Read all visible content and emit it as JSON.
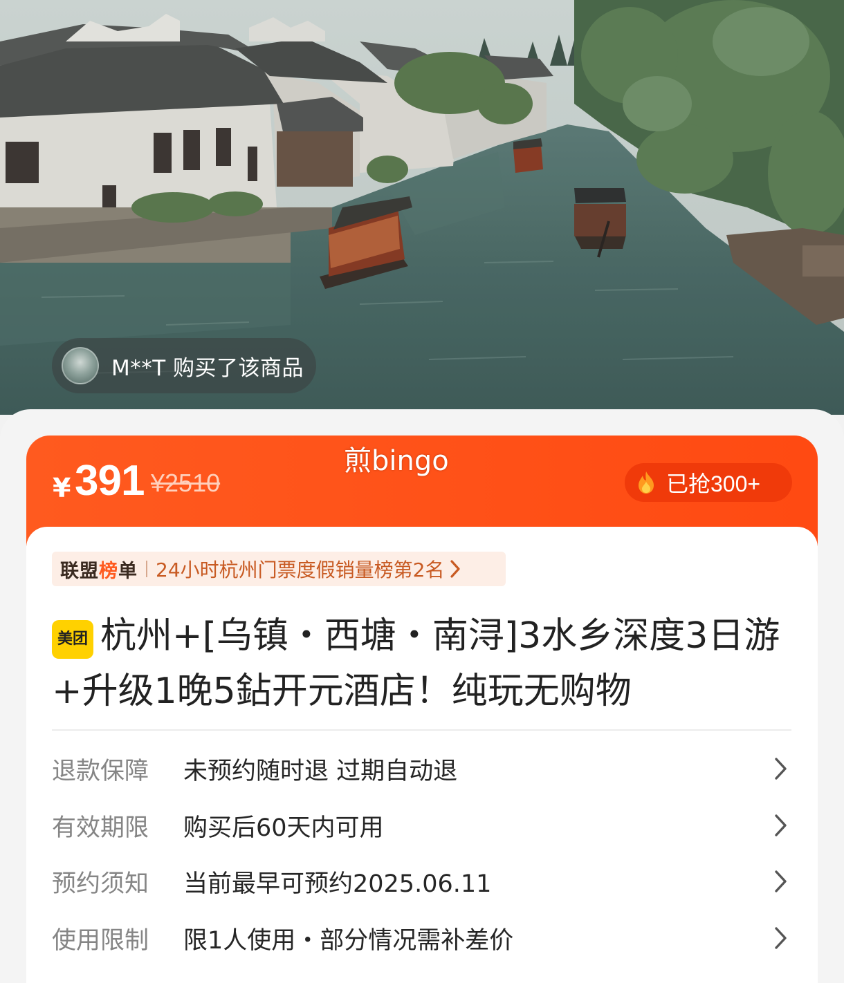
{
  "hero": {
    "buyer_notice": "M**T 购买了该商品"
  },
  "price": {
    "currency": "¥",
    "current": "391",
    "original": "¥2510",
    "watermark": "煎bingo",
    "sold": "已抢300+",
    "accent_color": "#ff4a12"
  },
  "ranking": {
    "brand_prefix": "联盟",
    "brand_accent": "榜",
    "brand_suffix": "单",
    "text": "24小时杭州门票度假销量榜第2名"
  },
  "product": {
    "badge": "美团",
    "title": "杭州+[乌镇・西塘・南浔]3水乡深度3日游+升级1晚5鉆开元酒店！纯玩无购物"
  },
  "info_rows": [
    {
      "label": "退款保障",
      "value": "未预约随时退 过期自动退"
    },
    {
      "label": "有效期限",
      "value": "购买后60天内可用"
    },
    {
      "label": "预约须知",
      "value": "当前最早可预约2025.06.11"
    },
    {
      "label": "使用限制",
      "value": "限1人使用・部分情况需补差价"
    }
  ],
  "icons": {
    "flame": "flame-icon",
    "chevron": "chevron-right-icon"
  }
}
